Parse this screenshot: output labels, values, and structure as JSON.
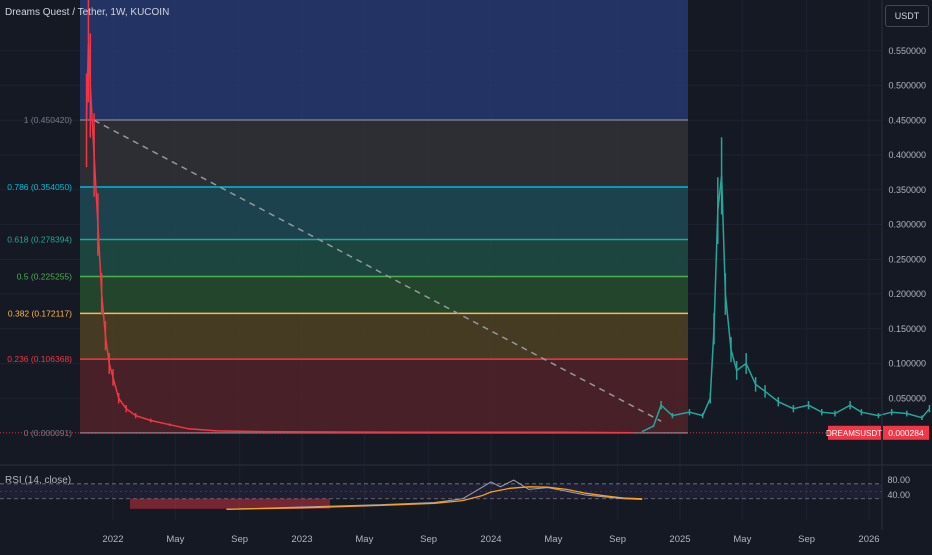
{
  "header": {
    "title": "Dreams Quest / Tether, 1W, KUCOIN",
    "currency": "USDT"
  },
  "rsi": {
    "title": "RSI (14, close)",
    "ticks": [
      "80.00",
      "40.00"
    ]
  },
  "chart_data": {
    "type": "candlestick",
    "symbol": "DREAMSUSDT",
    "last_price": "0.000284",
    "y_ticks": [
      "0.550000",
      "0.500000",
      "0.450000",
      "0.400000",
      "0.350000",
      "0.300000",
      "0.250000",
      "0.200000",
      "0.150000",
      "0.100000",
      "0.050000"
    ],
    "y_tick_values": [
      0.55,
      0.5,
      0.45,
      0.4,
      0.35,
      0.3,
      0.25,
      0.2,
      0.15,
      0.1,
      0.05
    ],
    "ylim": [
      0,
      0.63
    ],
    "x_ticks": [
      "2022",
      "May",
      "Sep",
      "2023",
      "May",
      "Sep",
      "2024",
      "May",
      "Sep",
      "2025",
      "May",
      "Sep",
      "2026"
    ],
    "fib_levels": [
      {
        "label": "1 (0.450420)",
        "ratio": 1,
        "price": 0.45042,
        "color": "#787b86"
      },
      {
        "label": "0.786 (0.354050)",
        "ratio": 0.786,
        "price": 0.35405,
        "color": "#00bcd4"
      },
      {
        "label": "0.618 (0.278394)",
        "ratio": 0.618,
        "price": 0.278394,
        "color": "#26a69a"
      },
      {
        "label": "0.5 (0.225255)",
        "ratio": 0.5,
        "price": 0.225255,
        "color": "#4caf50"
      },
      {
        "label": "0.382 (0.172117)",
        "ratio": 0.382,
        "price": 0.172117,
        "color": "#ffb74d"
      },
      {
        "label": "0.236 (0.106368)",
        "ratio": 0.236,
        "price": 0.106368,
        "color": "#f23645"
      },
      {
        "label": "0 (0.000091)",
        "ratio": 0,
        "price": 9.1e-05,
        "color": "#787b86"
      }
    ],
    "series": [
      {
        "name": "early_decline",
        "color": "#f23645",
        "points": [
          [
            2021.86,
            0.45
          ],
          [
            2021.87,
            0.56
          ],
          [
            2021.88,
            0.5
          ],
          [
            2021.9,
            0.4
          ],
          [
            2021.92,
            0.3
          ],
          [
            2021.94,
            0.2
          ],
          [
            2021.96,
            0.14
          ],
          [
            2021.98,
            0.1
          ],
          [
            2022.0,
            0.08
          ],
          [
            2022.03,
            0.05
          ],
          [
            2022.07,
            0.035
          ],
          [
            2022.12,
            0.025
          ],
          [
            2022.2,
            0.018
          ],
          [
            2022.3,
            0.012
          ],
          [
            2022.4,
            0.006
          ],
          [
            2022.55,
            0.003
          ],
          [
            2022.8,
            0.002
          ],
          [
            2023.2,
            0.0015
          ],
          [
            2023.6,
            0.001
          ],
          [
            2024.0,
            0.0012
          ],
          [
            2024.4,
            0.0011
          ],
          [
            2024.75,
            0.0005
          ]
        ]
      },
      {
        "name": "recent_move",
        "color": "#26a69a",
        "points": [
          [
            2024.8,
            0.002
          ],
          [
            2024.86,
            0.01
          ],
          [
            2024.9,
            0.04
          ],
          [
            2024.96,
            0.025
          ],
          [
            2025.05,
            0.03
          ],
          [
            2025.12,
            0.025
          ],
          [
            2025.16,
            0.05
          ],
          [
            2025.18,
            0.15
          ],
          [
            2025.2,
            0.32
          ],
          [
            2025.22,
            0.37
          ],
          [
            2025.24,
            0.2
          ],
          [
            2025.27,
            0.12
          ],
          [
            2025.3,
            0.09
          ],
          [
            2025.35,
            0.1
          ],
          [
            2025.4,
            0.07
          ],
          [
            2025.45,
            0.06
          ],
          [
            2025.52,
            0.045
          ],
          [
            2025.6,
            0.035
          ],
          [
            2025.68,
            0.04
          ],
          [
            2025.75,
            0.03
          ],
          [
            2025.82,
            0.028
          ],
          [
            2025.9,
            0.04
          ],
          [
            2025.96,
            0.03
          ],
          [
            2026.05,
            0.025
          ],
          [
            2026.12,
            0.03
          ],
          [
            2026.2,
            0.028
          ],
          [
            2026.28,
            0.022
          ],
          [
            2026.32,
            0.035
          ]
        ]
      }
    ],
    "trend_line": [
      [
        2021.9,
        0.45
      ],
      [
        2024.9,
        0.017
      ]
    ],
    "rsi_series": {
      "rsi": [
        [
          2022.6,
          2
        ],
        [
          2023.0,
          8
        ],
        [
          2023.4,
          14
        ],
        [
          2023.7,
          20
        ],
        [
          2023.85,
          30
        ],
        [
          2023.95,
          60
        ],
        [
          2024.0,
          75
        ],
        [
          2024.05,
          62
        ],
        [
          2024.12,
          80
        ],
        [
          2024.2,
          55
        ],
        [
          2024.3,
          60
        ],
        [
          2024.4,
          50
        ],
        [
          2024.5,
          40
        ],
        [
          2024.6,
          35
        ],
        [
          2024.7,
          30
        ],
        [
          2024.8,
          28
        ]
      ],
      "ma": [
        [
          2022.6,
          2
        ],
        [
          2023.0,
          6
        ],
        [
          2023.4,
          12
        ],
        [
          2023.7,
          18
        ],
        [
          2023.85,
          25
        ],
        [
          2023.95,
          38
        ],
        [
          2024.0,
          48
        ],
        [
          2024.1,
          58
        ],
        [
          2024.2,
          62
        ],
        [
          2024.3,
          61
        ],
        [
          2024.4,
          55
        ],
        [
          2024.5,
          45
        ],
        [
          2024.6,
          38
        ],
        [
          2024.7,
          32
        ],
        [
          2024.8,
          30
        ]
      ]
    }
  }
}
